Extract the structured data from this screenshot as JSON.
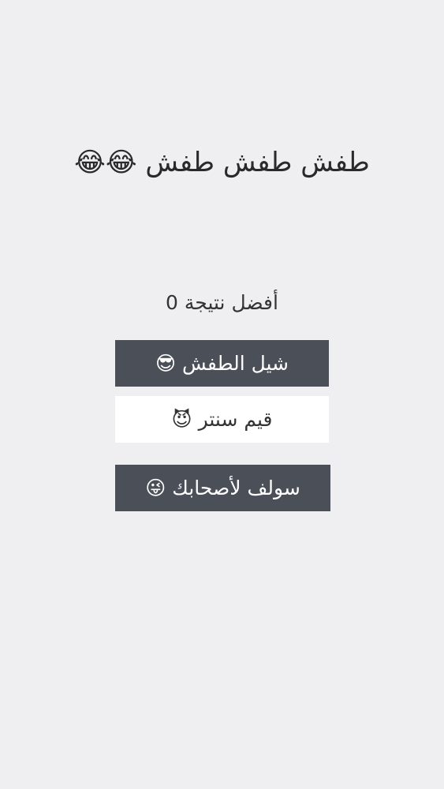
{
  "title": "طفش طفش طفش 😂😂",
  "best_score": {
    "label": "أفضل نتيجة",
    "value": "0"
  },
  "buttons": [
    {
      "label": "شيل الطفش",
      "emoji": "😎"
    },
    {
      "label": "قيم سنتر",
      "emoji": "😈"
    },
    {
      "label": "سولف لأصحابك",
      "emoji": "😜"
    }
  ]
}
